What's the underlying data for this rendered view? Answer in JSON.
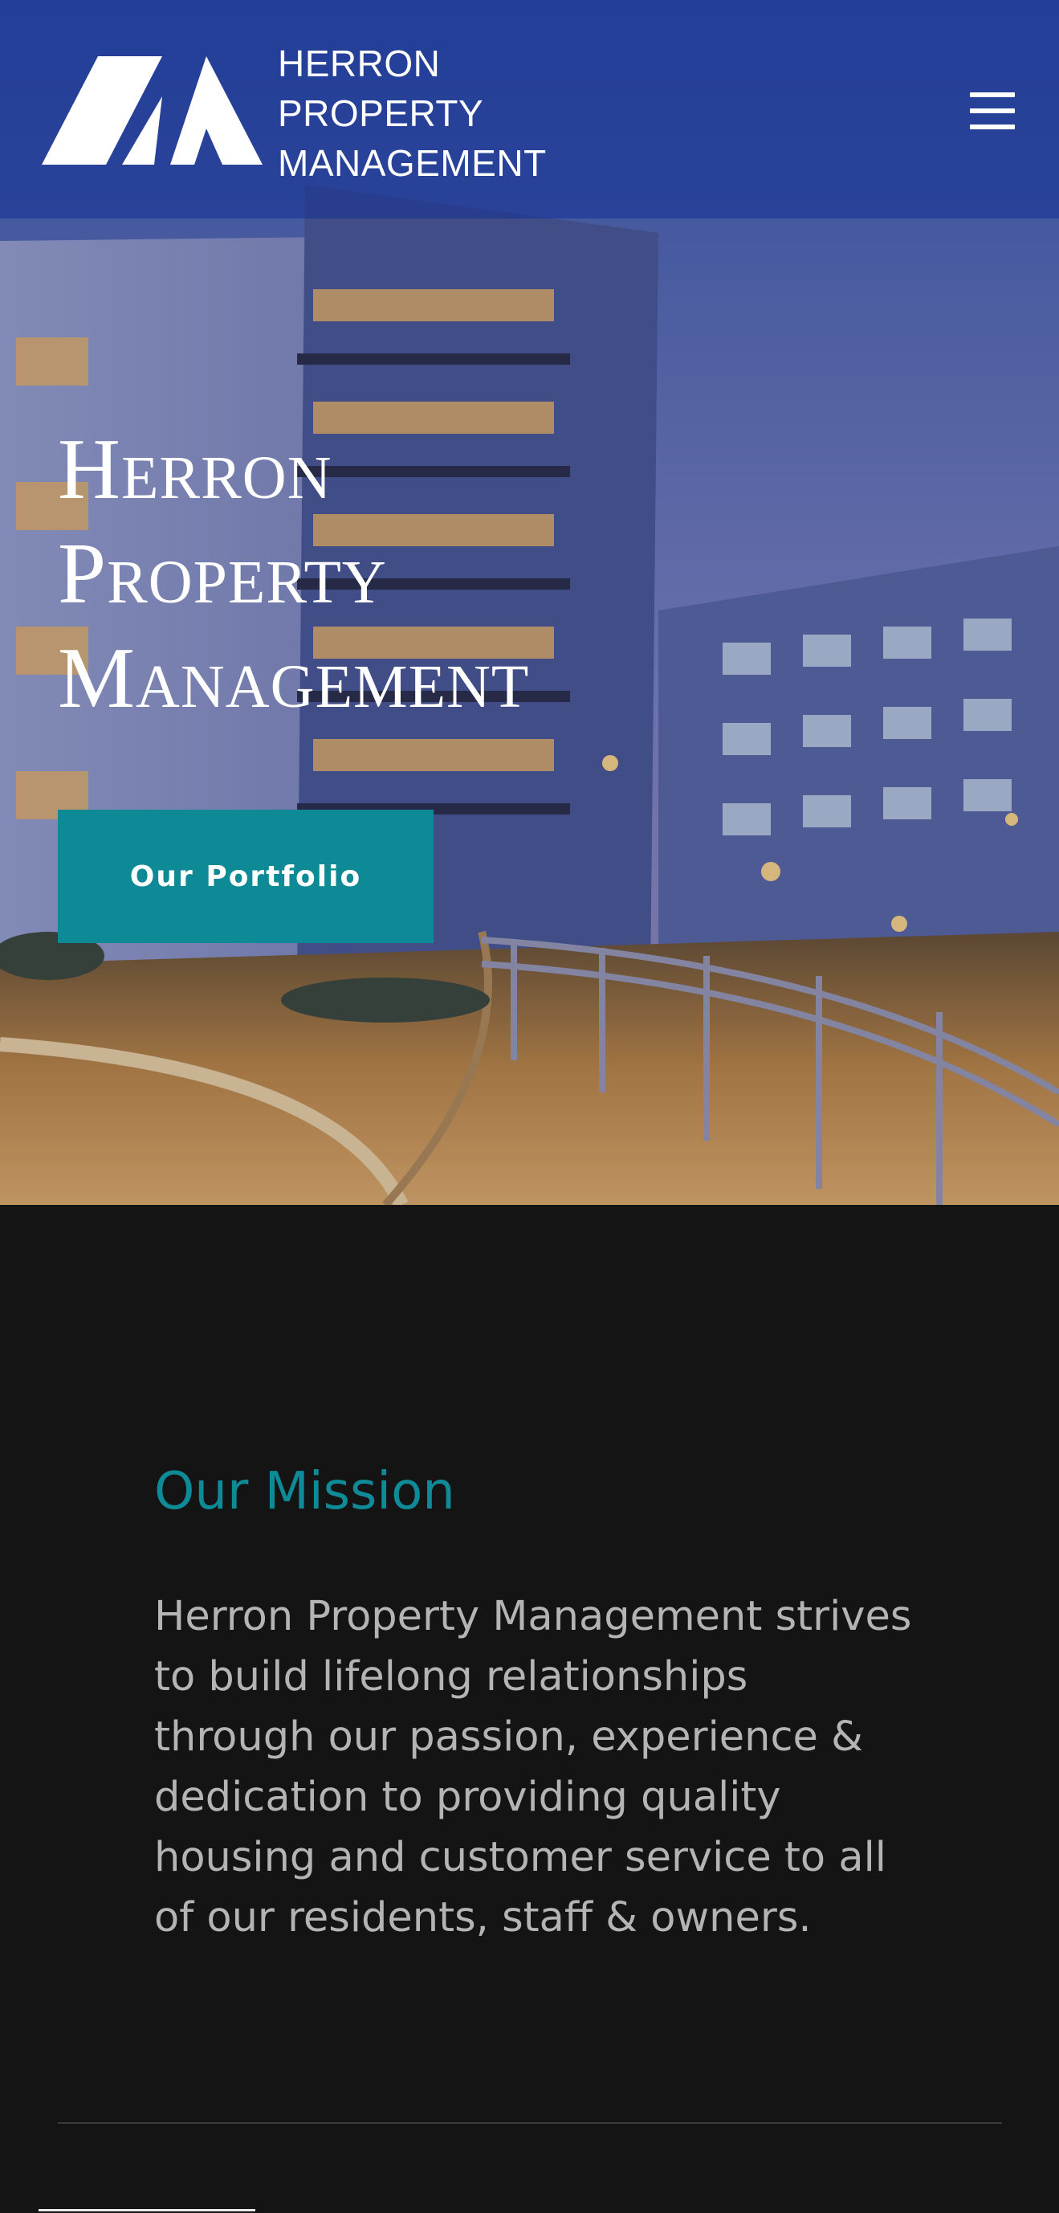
{
  "header": {
    "brand_lines": [
      "HERRON",
      "PROPERTY",
      "MANAGEMENT"
    ],
    "logo_icon": "hm-logo-icon",
    "menu_icon": "hamburger-menu-icon"
  },
  "hero": {
    "title_lines": [
      "Herron",
      "Property",
      "Management"
    ],
    "cta_label": "Our Portfolio",
    "cta_color": "#0d8a96"
  },
  "mission": {
    "heading": "Our Mission",
    "body_lines": [
      "Herron Property Management strives",
      "to build lifelong relationships",
      "through our passion, experience &",
      "dedication to providing quality",
      "housing and customer service to all",
      "of our residents, staff & owners."
    ],
    "heading_color": "#0f8a97"
  }
}
